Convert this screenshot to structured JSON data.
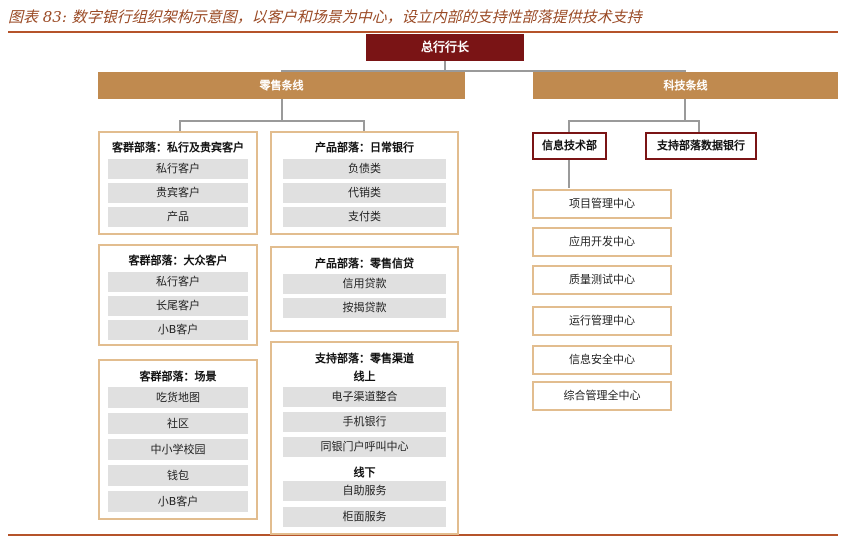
{
  "title": "图表 83: 数字银行组织架构示意图，以客户和场景为中心，设立内部的支持性部落提供技术支持",
  "top_node": "总行行长",
  "retail_line": "零售条线",
  "tech_line": "科技条线",
  "panels": {
    "private": {
      "title": "客群部落：私行及贵宾客户",
      "items": [
        "私行客户",
        "贵宾客户",
        "产品"
      ]
    },
    "mass": {
      "title": "客群部落：大众客户",
      "items": [
        "私行客户",
        "长尾客户",
        "小B客户"
      ]
    },
    "scene": {
      "title": "客群部落：场景",
      "items": [
        "吃货地图",
        "社区",
        "中小学校园",
        "钱包",
        "小B客户"
      ]
    },
    "daily": {
      "title": "产品部落：日常银行",
      "items": [
        "负债类",
        "代销类",
        "支付类"
      ]
    },
    "credit": {
      "title": "产品部落：零售信贷",
      "items": [
        "信用贷款",
        "按揭贷款"
      ]
    },
    "channel": {
      "title1": "支持部落：零售渠道",
      "online": "线上",
      "online_items": [
        "电子渠道整合",
        "手机银行",
        "同银门户呼叫中心"
      ],
      "offline": "线下",
      "offline_items": [
        "自助服务",
        "柜面服务"
      ]
    }
  },
  "tech": {
    "info_dept": "信息技术部",
    "support_dept": "支持部落数据银行",
    "centers": [
      "项目管理中心",
      "应用开发中心",
      "质量测试中心",
      "运行管理中心",
      "信息安全中心",
      "综合管理全中心"
    ]
  }
}
